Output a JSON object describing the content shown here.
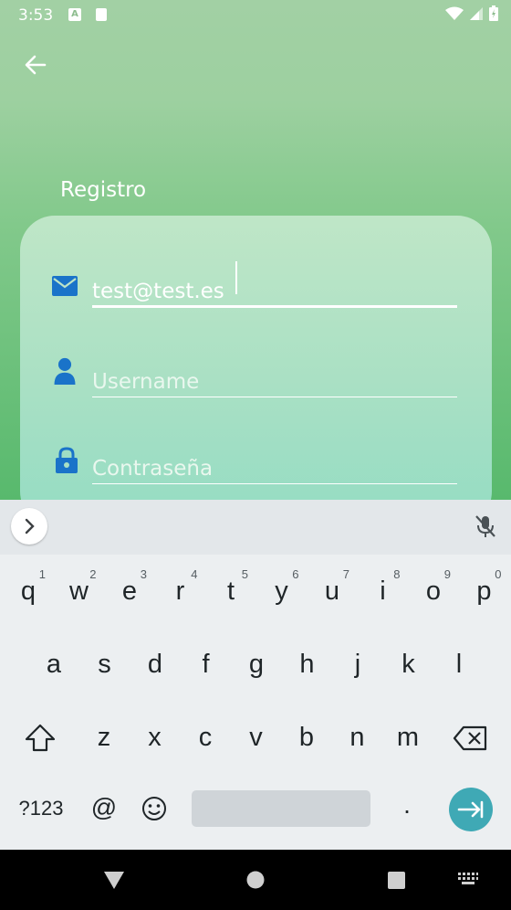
{
  "status_bar": {
    "time": "3:53",
    "notif_a": "A",
    "notif_b": ""
  },
  "page": {
    "title": "Registro"
  },
  "form": {
    "email": {
      "value": "test@test.es",
      "placeholder": ""
    },
    "username": {
      "value": "",
      "placeholder": "Username"
    },
    "password": {
      "value": "",
      "placeholder": "Contraseña"
    }
  },
  "keyboard": {
    "row1": [
      {
        "ch": "q",
        "num": "1"
      },
      {
        "ch": "w",
        "num": "2"
      },
      {
        "ch": "e",
        "num": "3"
      },
      {
        "ch": "r",
        "num": "4"
      },
      {
        "ch": "t",
        "num": "5"
      },
      {
        "ch": "y",
        "num": "6"
      },
      {
        "ch": "u",
        "num": "7"
      },
      {
        "ch": "i",
        "num": "8"
      },
      {
        "ch": "o",
        "num": "9"
      },
      {
        "ch": "p",
        "num": "0"
      }
    ],
    "row2": [
      "a",
      "s",
      "d",
      "f",
      "g",
      "h",
      "j",
      "k",
      "l"
    ],
    "row3": [
      "z",
      "x",
      "c",
      "v",
      "b",
      "n",
      "m"
    ],
    "symbols_label": "?123",
    "at_label": "@",
    "period_label": ".",
    "accent_color": "#3fa9b5"
  },
  "icons": [
    "back-arrow-icon",
    "email-icon",
    "person-icon",
    "lock-icon",
    "chevron-right-icon",
    "mic-off-icon",
    "shift-icon",
    "backspace-icon",
    "emoji-icon",
    "enter-icon",
    "nav-back-icon",
    "nav-home-icon",
    "nav-recents-icon",
    "keyboard-icon"
  ]
}
